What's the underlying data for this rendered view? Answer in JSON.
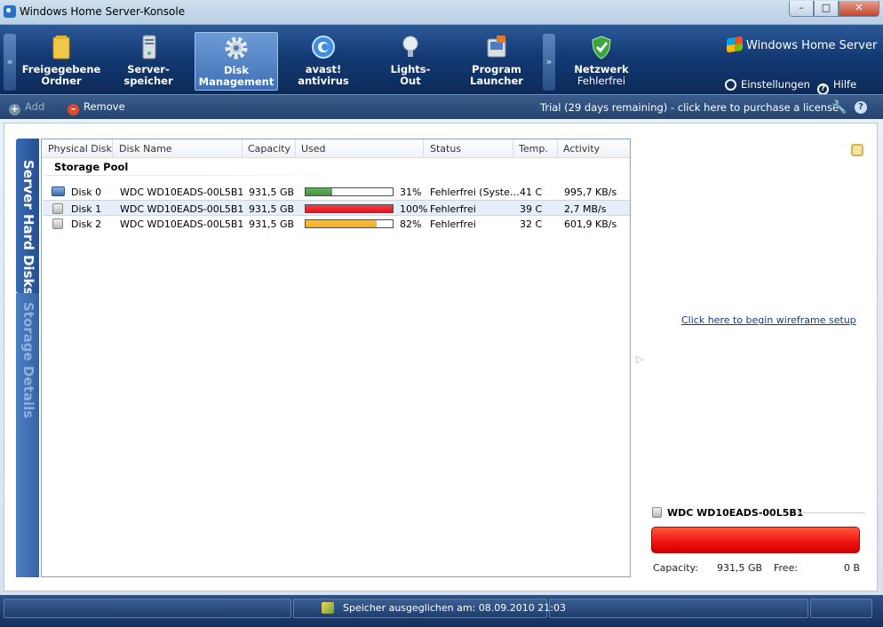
{
  "window": {
    "title": "Windows Home Server-Konsole",
    "minimize_glyph": "–",
    "maximize_glyph": "□",
    "close_glyph": "✕"
  },
  "nav": {
    "scroll_left": "«",
    "scroll_right": "»",
    "tabs": [
      {
        "label": "Freigegebene\nOrdner",
        "icon": "folder-icon"
      },
      {
        "label": "Server-\nspeicher",
        "icon": "server-icon"
      },
      {
        "label": "Disk\nManagement",
        "icon": "gear-icon",
        "active": true
      },
      {
        "label": "avast!\nantivirus",
        "icon": "avast-icon"
      },
      {
        "label": "Lights-\nOut",
        "icon": "lightbulb-icon"
      },
      {
        "label": "Program\nLauncher",
        "icon": "launcher-icon"
      }
    ],
    "network": {
      "label": "Netzwerk",
      "status": "Fehlerfrei",
      "icon": "shield-check-icon"
    },
    "brand": "Windows Home Server",
    "settings_label": "Einstellungen",
    "help_label": "Hilfe"
  },
  "toolbar": {
    "add_label": "Add",
    "remove_label": "Remove",
    "trial_text": "Trial (29 days remaining) - click here to purchase a license"
  },
  "side_tabs": {
    "server_hard_disks": "Server Hard Disks",
    "storage_details": "Storage Details"
  },
  "table": {
    "columns": [
      "Physical Disk",
      "Disk Name",
      "Capacity",
      "Used",
      "Status",
      "Temp.",
      "Activity"
    ],
    "group": "Storage Pool",
    "rows": [
      {
        "disk": "Disk 0",
        "name": "WDC WD10EADS-00L5B1",
        "capacity": "931,5 GB",
        "used_pct": 31,
        "used": "31%",
        "status": "Fehlerfrei (Syste…",
        "temp": "41 C",
        "activity": "995,7 KB/s",
        "bar_color": "#3f9a3a",
        "system": true
      },
      {
        "disk": "Disk 1",
        "name": "WDC WD10EADS-00L5B1",
        "capacity": "931,5 GB",
        "used_pct": 100,
        "used": "100%",
        "status": "Fehlerfrei",
        "temp": "39 C",
        "activity": "2,7 MB/s",
        "bar_color": "#e8121a",
        "selected": true
      },
      {
        "disk": "Disk 2",
        "name": "WDC WD10EADS-00L5B1",
        "capacity": "931,5 GB",
        "used_pct": 82,
        "used": "82%",
        "status": "Fehlerfrei",
        "temp": "32 C",
        "activity": "601,9 KB/s",
        "bar_color": "#f2b01e"
      }
    ]
  },
  "details": {
    "wireframe_link": "Click here to begin wireframe setup",
    "disk_name": "WDC WD10EADS-00L5B1",
    "capacity_label": "Capacity:",
    "capacity_value": "931,5 GB",
    "free_label": "Free:",
    "free_value": "0 B",
    "used_fraction": 1.0
  },
  "statusbar": {
    "text": "Speicher ausgeglichen am: 08.09.2010 21:03"
  }
}
